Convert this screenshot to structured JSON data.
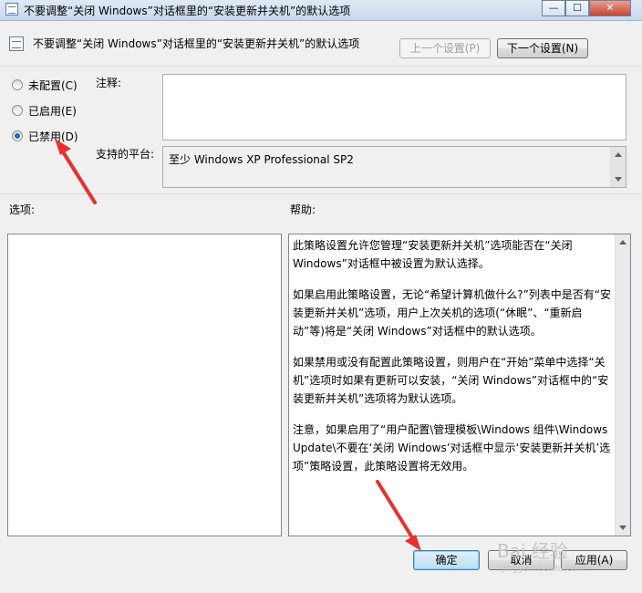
{
  "window": {
    "title": "不要调整“关闭 Windows”对话框里的“安装更新并关机”的默认选项",
    "controls": {
      "minimize": "—",
      "maximize": "☐",
      "close": "✕"
    }
  },
  "header": {
    "policy_title": "不要调整“关闭 Windows”对话框里的“安装更新并关机”的默认选项",
    "prev_button": "上一个设置(P)",
    "next_button": "下一个设置(N)"
  },
  "state": {
    "options": [
      {
        "label": "未配置(C)",
        "selected": false
      },
      {
        "label": "已启用(E)",
        "selected": false
      },
      {
        "label": "已禁用(D)",
        "selected": true
      }
    ]
  },
  "comment": {
    "label": "注释:",
    "value": ""
  },
  "platform": {
    "label": "支持的平台:",
    "value": "至少 Windows XP Professional SP2"
  },
  "options_section": {
    "label": "选项:"
  },
  "help": {
    "label": "帮助:",
    "paragraphs": [
      "此策略设置允许您管理“安装更新并关机”选项能否在“关闭 Windows”对话框中被设置为默认选择。",
      "如果启用此策略设置，无论“希望计算机做什么?”列表中是否有“安装更新并关机”选项，用户上次关机的选项(“休眠”、“重新启动”等)将是“关闭 Windows”对话框中的默认选项。",
      "如果禁用或没有配置此策略设置，则用户在“开始”菜单中选择“关机”选项时如果有更新可以安装，“关闭 Windows”对话框中的“安装更新并关机”选项将为默认选项。",
      "注意，如果启用了“用户配置\\管理模板\\Windows 组件\\Windows Update\\不要在‘关闭 Windows’对话框中显示‘安装更新并关机’选项”策略设置，此策略设置将无效用。"
    ]
  },
  "footer": {
    "ok_button": "确定",
    "cancel_button": "取消",
    "apply_button": "应用(A)"
  },
  "watermark": {
    "text": "Bai 经验",
    "subtext": "jingyan.baidu.com"
  },
  "colors": {
    "annotation_arrow": "#e8312f",
    "selected_radio": "#1f6fb8"
  }
}
